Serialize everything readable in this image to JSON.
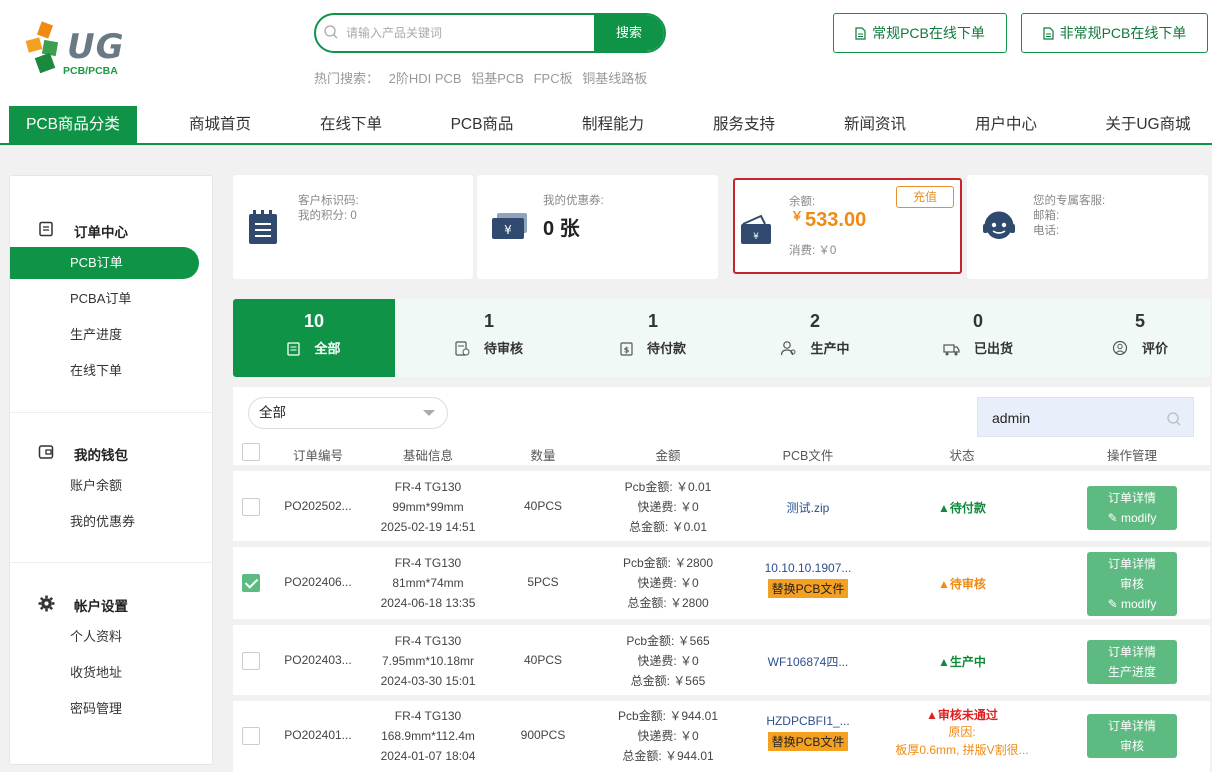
{
  "header": {
    "logo_text": "UG",
    "logo_sub": "PCB/PCBA",
    "search_placeholder": "请输入产品关键词",
    "search_button": "搜索",
    "hot_label": "热门搜索：",
    "hot_terms": [
      "2阶HDI PCB",
      "铝基PCB",
      "FPC板",
      "铜基线路板"
    ],
    "btn_regular": "常规PCB在线下单",
    "btn_irregular": "非常规PCB在线下单"
  },
  "nav": [
    "PCB商品分类",
    "商城首页",
    "在线下单",
    "PCB商品",
    "制程能力",
    "服务支持",
    "新闻资讯",
    "用户中心",
    "关于UG商城"
  ],
  "sidebar": {
    "orders_title": "订单中心",
    "orders_items": [
      "PCB订单",
      "PCBA订单",
      "生产进度",
      "在线下单"
    ],
    "wallet_title": "我的钱包",
    "wallet_items": [
      "账户余额",
      "我的优惠券"
    ],
    "account_title": "帐户设置",
    "account_items": [
      "个人资料",
      "收货地址",
      "密码管理"
    ]
  },
  "cards": {
    "customer_code": "客户标识码:",
    "points": "我的积分: 0",
    "coupon_label": "我的优惠券:",
    "coupon_value": "0 张",
    "balance_label": "余额:",
    "balance_currency": "￥",
    "balance_value": "533.00",
    "recharge": "充值",
    "spent": "消费: ￥0",
    "service_label": "您的专属客服:",
    "email_label": "邮箱:",
    "phone_label": "电话:"
  },
  "tabs": [
    {
      "count": "10",
      "label": "全部"
    },
    {
      "count": "1",
      "label": "待审核"
    },
    {
      "count": "1",
      "label": "待付款"
    },
    {
      "count": "2",
      "label": "生产中"
    },
    {
      "count": "0",
      "label": "已出货"
    },
    {
      "count": "5",
      "label": "评价"
    }
  ],
  "filter": {
    "select_value": "全部",
    "user_value": "admin"
  },
  "table": {
    "headers": [
      "订单编号",
      "基础信息",
      "数量",
      "金额",
      "PCB文件",
      "状态",
      "操作管理"
    ],
    "rows": [
      {
        "id": "PO202502...",
        "material": "FR-4 TG130",
        "size": "99mm*99mm",
        "date": "2025-02-19 14:51",
        "qty": "40PCS",
        "pcb": "Pcb金额: ￥0.01",
        "ship": "快递费: ￥0",
        "total": "总金额: ￥0.01",
        "file": "测试.zip",
        "replace": "",
        "status": "▲待付款",
        "reason_label": "",
        "reason": "",
        "op1": "订单详情",
        "op2": "✎ modify",
        "op3": ""
      },
      {
        "id": "PO202406...",
        "material": "FR-4 TG130",
        "size": "81mm*74mm",
        "date": "2024-06-18 13:35",
        "qty": "5PCS",
        "pcb": "Pcb金额: ￥2800",
        "ship": "快递费: ￥0",
        "total": "总金额: ￥2800",
        "file": "10.10.10.1907...",
        "replace": "替换PCB文件",
        "status": "▲待审核",
        "reason_label": "",
        "reason": "",
        "op1": "订单详情",
        "op2": "审核",
        "op3": "✎ modify"
      },
      {
        "id": "PO202403...",
        "material": "FR-4 TG130",
        "size": "7.95mm*10.18mr",
        "date": "2024-03-30 15:01",
        "qty": "40PCS",
        "pcb": "Pcb金额: ￥565",
        "ship": "快递费: ￥0",
        "total": "总金额: ￥565",
        "file": "WF106874四...",
        "replace": "",
        "status": "▲生产中",
        "reason_label": "",
        "reason": "",
        "op1": "订单详情",
        "op2": "生产进度",
        "op3": ""
      },
      {
        "id": "PO202401...",
        "material": "FR-4 TG130",
        "size": "168.9mm*112.4m",
        "date": "2024-01-07 18:04",
        "qty": "900PCS",
        "pcb": "Pcb金额: ￥944.01",
        "ship": "快递费: ￥0",
        "total": "总金额: ￥944.01",
        "file": "HZDPCBFI1_...",
        "replace": "替换PCB文件",
        "status": "▲审核未通过",
        "reason_label": "原因:",
        "reason": "板厚0.6mm, 拼版V割很...",
        "op1": "订单详情",
        "op2": "审核",
        "op3": ""
      }
    ]
  },
  "colors": {
    "brand": "#0f9447",
    "accent": "#f08a13",
    "danger": "#e02020"
  }
}
